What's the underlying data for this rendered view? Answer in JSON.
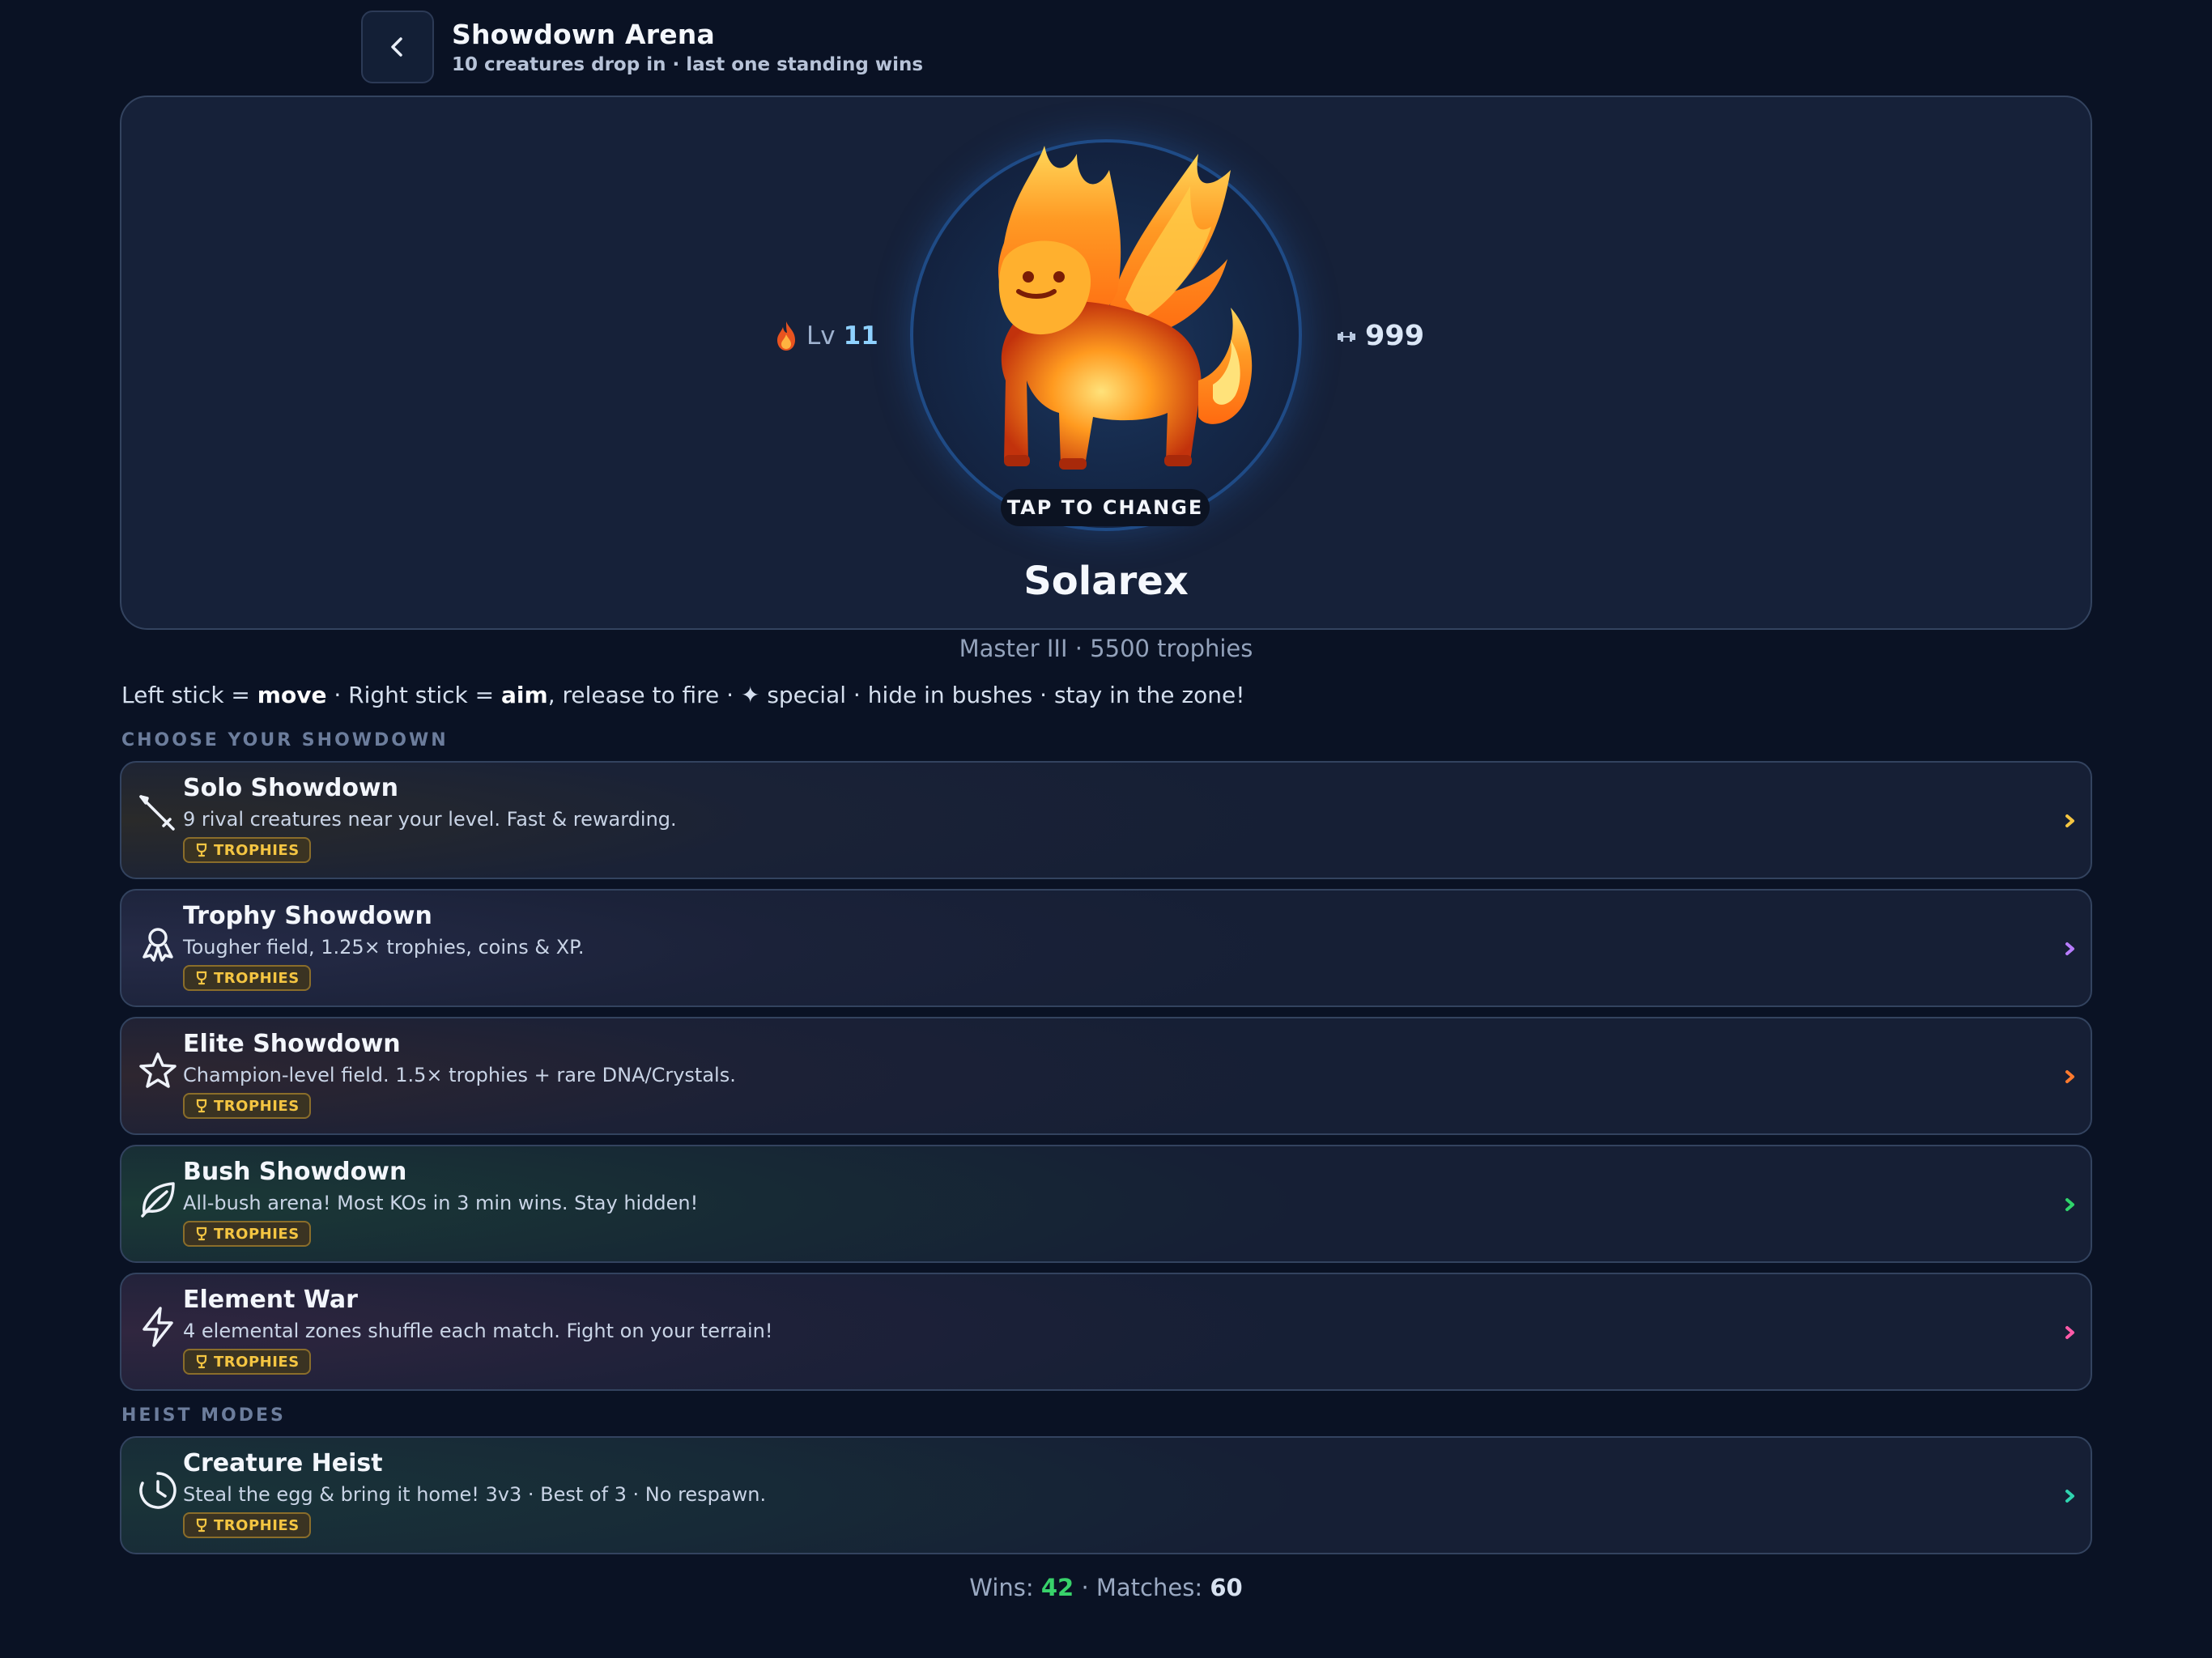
{
  "header": {
    "title": "Showdown Arena",
    "subtitle": "10 creatures drop in · last one standing wins"
  },
  "creature": {
    "level_label": "Lv",
    "level": "11",
    "power": "999",
    "tap_label": "TAP TO CHANGE",
    "name": "Solarex"
  },
  "rank_line": "Master III · 5500 trophies",
  "controls": {
    "part1": "Left stick = ",
    "move": "move",
    "part2": " · Right stick = ",
    "aim": "aim",
    "part3": ", release to fire · ✦ special · hide in bushes · stay in the zone!"
  },
  "sections": {
    "showdown": "CHOOSE YOUR SHOWDOWN",
    "heist": "HEIST MODES"
  },
  "modes": [
    {
      "title": "Solo Showdown",
      "desc": "9 rival creatures near your level. Fast & rewarding.",
      "badge": "TROPHIES",
      "icon": "sword-icon",
      "accent": "#f4c542"
    },
    {
      "title": "Trophy Showdown",
      "desc": "Tougher field, 1.25× trophies, coins & XP.",
      "badge": "TROPHIES",
      "icon": "medal-icon",
      "accent": "#b77cff"
    },
    {
      "title": "Elite Showdown",
      "desc": "Champion-level field. 1.5× trophies + rare DNA/Crystals.",
      "badge": "TROPHIES",
      "icon": "star-icon",
      "accent": "#ff7a2e"
    },
    {
      "title": "Bush Showdown",
      "desc": "All-bush arena! Most KOs in 3 min wins. Stay hidden!",
      "badge": "TROPHIES",
      "icon": "leaf-icon",
      "accent": "#2fd46b"
    },
    {
      "title": "Element War",
      "desc": "4 elemental zones shuffle each match. Fight on your terrain!",
      "badge": "TROPHIES",
      "icon": "lightning-icon",
      "accent": "#ff5aa8"
    },
    {
      "title": "Creature Heist",
      "desc": "Steal the egg & bring it home! 3v3 · Best of 3 · No respawn.",
      "badge": "TROPHIES",
      "icon": "clock-icon",
      "accent": "#2fd4b0"
    }
  ],
  "stats": {
    "wins_label": "Wins: ",
    "wins": "42",
    "sep": " · Matches: ",
    "matches": "60"
  }
}
